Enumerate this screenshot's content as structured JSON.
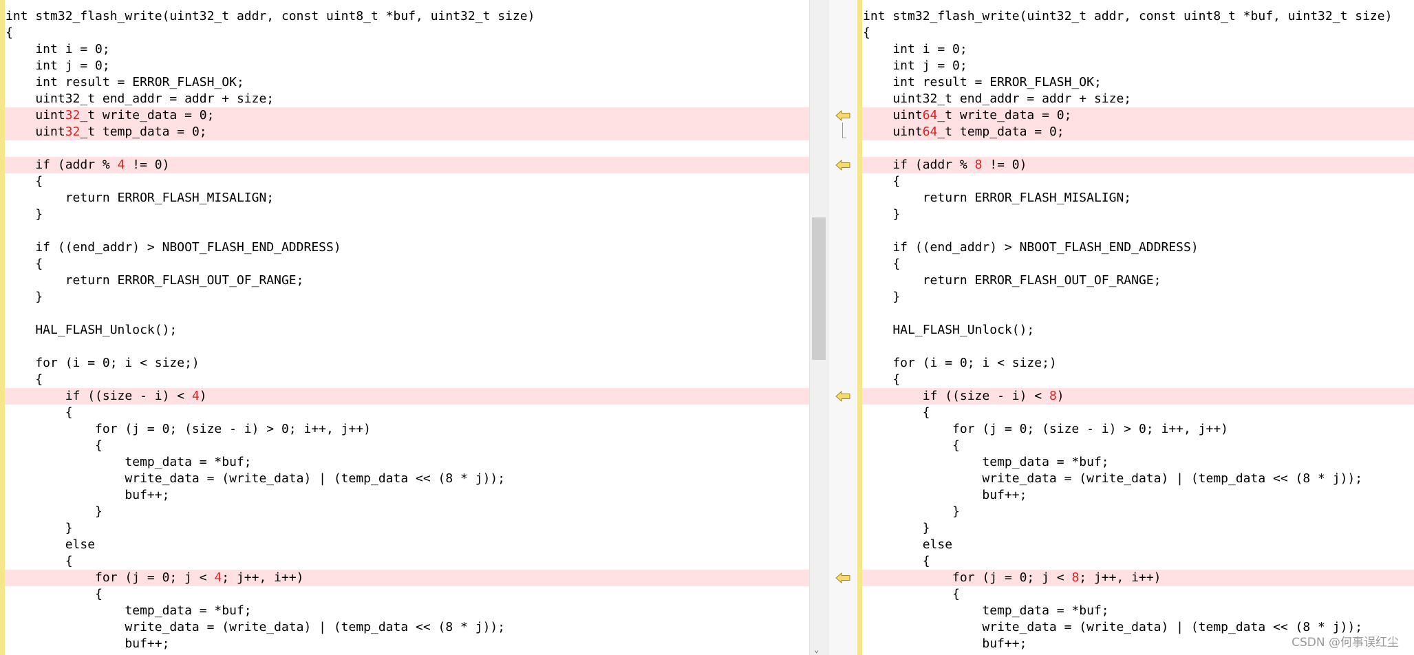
{
  "left_pane": {
    "lines": [
      {
        "kind": "same",
        "segments": [
          {
            "text": "int stm32_flash_write(uint32_t addr, const uint8_t *buf, uint32_t size)"
          }
        ]
      },
      {
        "kind": "same",
        "segments": [
          {
            "text": "{"
          }
        ]
      },
      {
        "kind": "same",
        "segments": [
          {
            "text": "    int i = 0;"
          }
        ]
      },
      {
        "kind": "same",
        "segments": [
          {
            "text": "    int j = 0;"
          }
        ]
      },
      {
        "kind": "same",
        "segments": [
          {
            "text": "    int result = ERROR_FLASH_OK;"
          }
        ]
      },
      {
        "kind": "same",
        "segments": [
          {
            "text": "    uint32_t end_addr = addr + size;"
          }
        ]
      },
      {
        "kind": "diff",
        "segments": [
          {
            "text": "    uint"
          },
          {
            "text": "32",
            "hl": true
          },
          {
            "text": "_t write_data = 0;"
          }
        ]
      },
      {
        "kind": "diff",
        "segments": [
          {
            "text": "    uint"
          },
          {
            "text": "32",
            "hl": true
          },
          {
            "text": "_t temp_data = 0;"
          }
        ]
      },
      {
        "kind": "same",
        "segments": [
          {
            "text": ""
          }
        ]
      },
      {
        "kind": "diff",
        "segments": [
          {
            "text": "    if (addr % "
          },
          {
            "text": "4",
            "hl": true
          },
          {
            "text": " != 0)"
          }
        ]
      },
      {
        "kind": "same",
        "segments": [
          {
            "text": "    {"
          }
        ]
      },
      {
        "kind": "same",
        "segments": [
          {
            "text": "        return ERROR_FLASH_MISALIGN;"
          }
        ]
      },
      {
        "kind": "same",
        "segments": [
          {
            "text": "    }"
          }
        ]
      },
      {
        "kind": "same",
        "segments": [
          {
            "text": ""
          }
        ]
      },
      {
        "kind": "same",
        "segments": [
          {
            "text": "    if ((end_addr) > NBOOT_FLASH_END_ADDRESS)"
          }
        ]
      },
      {
        "kind": "same",
        "segments": [
          {
            "text": "    {"
          }
        ]
      },
      {
        "kind": "same",
        "segments": [
          {
            "text": "        return ERROR_FLASH_OUT_OF_RANGE;"
          }
        ]
      },
      {
        "kind": "same",
        "segments": [
          {
            "text": "    }"
          }
        ]
      },
      {
        "kind": "same",
        "segments": [
          {
            "text": ""
          }
        ]
      },
      {
        "kind": "same",
        "segments": [
          {
            "text": "    HAL_FLASH_Unlock();"
          }
        ]
      },
      {
        "kind": "same",
        "segments": [
          {
            "text": ""
          }
        ]
      },
      {
        "kind": "same",
        "segments": [
          {
            "text": "    for (i = 0; i < size;)"
          }
        ]
      },
      {
        "kind": "same",
        "segments": [
          {
            "text": "    {"
          }
        ]
      },
      {
        "kind": "diff",
        "segments": [
          {
            "text": "        if ((size - i) < "
          },
          {
            "text": "4",
            "hl": true
          },
          {
            "text": ")"
          }
        ]
      },
      {
        "kind": "same",
        "segments": [
          {
            "text": "        {"
          }
        ]
      },
      {
        "kind": "same",
        "segments": [
          {
            "text": "            for (j = 0; (size - i) > 0; i++, j++)"
          }
        ]
      },
      {
        "kind": "same",
        "segments": [
          {
            "text": "            {"
          }
        ]
      },
      {
        "kind": "same",
        "segments": [
          {
            "text": "                temp_data = *buf;"
          }
        ]
      },
      {
        "kind": "same",
        "segments": [
          {
            "text": "                write_data = (write_data) | (temp_data << (8 * j));"
          }
        ]
      },
      {
        "kind": "same",
        "segments": [
          {
            "text": "                buf++;"
          }
        ]
      },
      {
        "kind": "same",
        "segments": [
          {
            "text": "            }"
          }
        ]
      },
      {
        "kind": "same",
        "segments": [
          {
            "text": "        }"
          }
        ]
      },
      {
        "kind": "same",
        "segments": [
          {
            "text": "        else"
          }
        ]
      },
      {
        "kind": "same",
        "segments": [
          {
            "text": "        {"
          }
        ]
      },
      {
        "kind": "diff",
        "segments": [
          {
            "text": "            for (j = 0; j < "
          },
          {
            "text": "4",
            "hl": true
          },
          {
            "text": "; j++, i++)"
          }
        ]
      },
      {
        "kind": "same",
        "segments": [
          {
            "text": "            {"
          }
        ]
      },
      {
        "kind": "same",
        "segments": [
          {
            "text": "                temp_data = *buf;"
          }
        ]
      },
      {
        "kind": "same",
        "segments": [
          {
            "text": "                write_data = (write_data) | (temp_data << (8 * j));"
          }
        ]
      },
      {
        "kind": "same",
        "segments": [
          {
            "text": "                buf++;"
          }
        ]
      }
    ]
  },
  "right_pane": {
    "lines": [
      {
        "kind": "same",
        "segments": [
          {
            "text": "int stm32_flash_write(uint32_t addr, const uint8_t *buf, uint32_t size)"
          }
        ]
      },
      {
        "kind": "same",
        "segments": [
          {
            "text": "{"
          }
        ]
      },
      {
        "kind": "same",
        "segments": [
          {
            "text": "    int i = 0;"
          }
        ]
      },
      {
        "kind": "same",
        "segments": [
          {
            "text": "    int j = 0;"
          }
        ]
      },
      {
        "kind": "same",
        "segments": [
          {
            "text": "    int result = ERROR_FLASH_OK;"
          }
        ]
      },
      {
        "kind": "same",
        "segments": [
          {
            "text": "    uint32_t end_addr = addr + size;"
          }
        ]
      },
      {
        "kind": "diff",
        "segments": [
          {
            "text": "    uint"
          },
          {
            "text": "64",
            "hl": true
          },
          {
            "text": "_t write_data = 0;"
          }
        ]
      },
      {
        "kind": "diff",
        "segments": [
          {
            "text": "    uint"
          },
          {
            "text": "64",
            "hl": true
          },
          {
            "text": "_t temp_data = 0;"
          }
        ]
      },
      {
        "kind": "same",
        "segments": [
          {
            "text": ""
          }
        ]
      },
      {
        "kind": "diff",
        "segments": [
          {
            "text": "    if (addr % "
          },
          {
            "text": "8",
            "hl": true
          },
          {
            "text": " != 0)"
          }
        ]
      },
      {
        "kind": "same",
        "segments": [
          {
            "text": "    {"
          }
        ]
      },
      {
        "kind": "same",
        "segments": [
          {
            "text": "        return ERROR_FLASH_MISALIGN;"
          }
        ]
      },
      {
        "kind": "same",
        "segments": [
          {
            "text": "    }"
          }
        ]
      },
      {
        "kind": "same",
        "segments": [
          {
            "text": ""
          }
        ]
      },
      {
        "kind": "same",
        "segments": [
          {
            "text": "    if ((end_addr) > NBOOT_FLASH_END_ADDRESS)"
          }
        ]
      },
      {
        "kind": "same",
        "segments": [
          {
            "text": "    {"
          }
        ]
      },
      {
        "kind": "same",
        "segments": [
          {
            "text": "        return ERROR_FLASH_OUT_OF_RANGE;"
          }
        ]
      },
      {
        "kind": "same",
        "segments": [
          {
            "text": "    }"
          }
        ]
      },
      {
        "kind": "same",
        "segments": [
          {
            "text": ""
          }
        ]
      },
      {
        "kind": "same",
        "segments": [
          {
            "text": "    HAL_FLASH_Unlock();"
          }
        ]
      },
      {
        "kind": "same",
        "segments": [
          {
            "text": ""
          }
        ]
      },
      {
        "kind": "same",
        "segments": [
          {
            "text": "    for (i = 0; i < size;)"
          }
        ]
      },
      {
        "kind": "same",
        "segments": [
          {
            "text": "    {"
          }
        ]
      },
      {
        "kind": "diff",
        "segments": [
          {
            "text": "        if ((size - i) < "
          },
          {
            "text": "8",
            "hl": true
          },
          {
            "text": ")"
          }
        ]
      },
      {
        "kind": "same",
        "segments": [
          {
            "text": "        {"
          }
        ]
      },
      {
        "kind": "same",
        "segments": [
          {
            "text": "            for (j = 0; (size - i) > 0; i++, j++)"
          }
        ]
      },
      {
        "kind": "same",
        "segments": [
          {
            "text": "            {"
          }
        ]
      },
      {
        "kind": "same",
        "segments": [
          {
            "text": "                temp_data = *buf;"
          }
        ]
      },
      {
        "kind": "same",
        "segments": [
          {
            "text": "                write_data = (write_data) | (temp_data << (8 * j));"
          }
        ]
      },
      {
        "kind": "same",
        "segments": [
          {
            "text": "                buf++;"
          }
        ]
      },
      {
        "kind": "same",
        "segments": [
          {
            "text": "            }"
          }
        ]
      },
      {
        "kind": "same",
        "segments": [
          {
            "text": "        }"
          }
        ]
      },
      {
        "kind": "same",
        "segments": [
          {
            "text": "        else"
          }
        ]
      },
      {
        "kind": "same",
        "segments": [
          {
            "text": "        {"
          }
        ]
      },
      {
        "kind": "diff",
        "segments": [
          {
            "text": "            for (j = 0; j < "
          },
          {
            "text": "8",
            "hl": true
          },
          {
            "text": "; j++, i++)"
          }
        ]
      },
      {
        "kind": "same",
        "segments": [
          {
            "text": "            {"
          }
        ]
      },
      {
        "kind": "same",
        "segments": [
          {
            "text": "                temp_data = *buf;"
          }
        ]
      },
      {
        "kind": "same",
        "segments": [
          {
            "text": "                write_data = (write_data) | (temp_data << (8 * j));"
          }
        ]
      },
      {
        "kind": "same",
        "segments": [
          {
            "text": "                buf++;"
          }
        ]
      }
    ]
  },
  "diff_markers": {
    "icon": "copy-to-right-arrow-icon",
    "rows": [
      6,
      9,
      23,
      34
    ]
  },
  "colors": {
    "diff_background": "#ffe1e3",
    "diff_token": "#e02020",
    "gutter_bar": "#f5e68a",
    "marker_fill": "#f4d870",
    "marker_stroke": "#a88a1c"
  },
  "watermark": {
    "text": "CSDN @何事误红尘"
  }
}
